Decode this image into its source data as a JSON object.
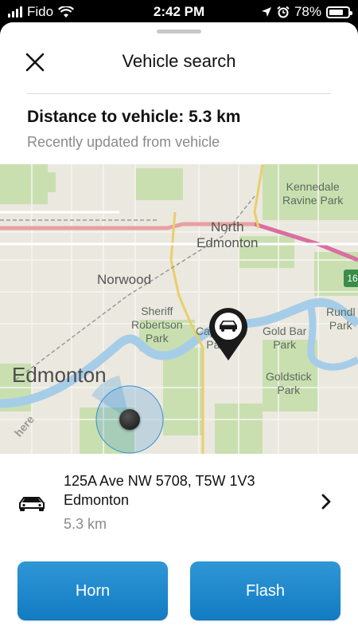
{
  "status_bar": {
    "carrier": "Fido",
    "time": "2:42 PM",
    "battery_percent": "78%",
    "battery_level": 0.78,
    "icons": [
      "signal-bars-icon",
      "wifi-icon",
      "location-arrow-icon",
      "alarm-icon",
      "battery-icon"
    ]
  },
  "header": {
    "title": "Vehicle search",
    "close_icon": "close-icon"
  },
  "info": {
    "distance": "Distance to vehicle: 5.3 km",
    "updated": "Recently updated from vehicle"
  },
  "map": {
    "labels": {
      "kennedale": "Kennedale\nRavine Park",
      "north_edmonton": "North\nEdmonton",
      "norwood": "Norwood",
      "sheriff": "Sheriff\nRobertson\nPark",
      "capilano": "Capilano\nPark",
      "gold_bar": "Gold Bar\nPark",
      "rundle": "Rundl\nPark",
      "edmonton": "Edmonton",
      "goldstick": "Goldstick\nPark",
      "here": "here",
      "highway": "16"
    },
    "accent_blue": "#2f8fd4",
    "river_color": "#a6cde8",
    "park_color": "#c9dfb0"
  },
  "vehicle": {
    "address": "125A Ave NW 5708, T5W 1V3 Edmonton",
    "distance": "5.3 km"
  },
  "actions": {
    "horn": "Horn",
    "flash": "Flash"
  },
  "colors": {
    "button": "#1f88cc",
    "text": "#111111",
    "secondary_text": "#8a8a8a"
  }
}
